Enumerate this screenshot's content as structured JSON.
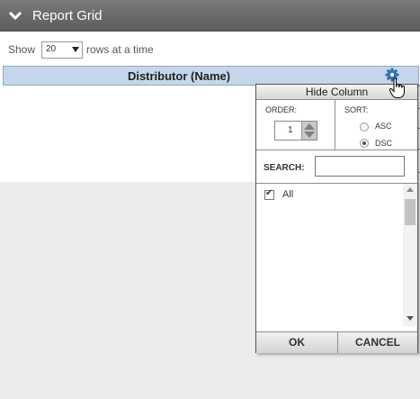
{
  "panel": {
    "title": "Report Grid",
    "show_label": "Show",
    "rows_value": "20",
    "rows_suffix": "rows at a time"
  },
  "column": {
    "name": "Distributor (Name)"
  },
  "popup": {
    "hide_column": "Hide Column",
    "order_label": "ORDER:",
    "order_value": "1",
    "sort_label": "SORT:",
    "sort_options": [
      {
        "label": "ASC",
        "selected": false
      },
      {
        "label": "DSC",
        "selected": true
      }
    ],
    "search_label": "SEARCH:",
    "search_value": "",
    "list_items": [
      {
        "label": "All",
        "checked": true
      }
    ],
    "ok_label": "OK",
    "cancel_label": "CANCEL"
  },
  "colors": {
    "header_bar": "#6a6a6a",
    "column_header": "#c5d6ea",
    "gear": "#2f6fae"
  }
}
